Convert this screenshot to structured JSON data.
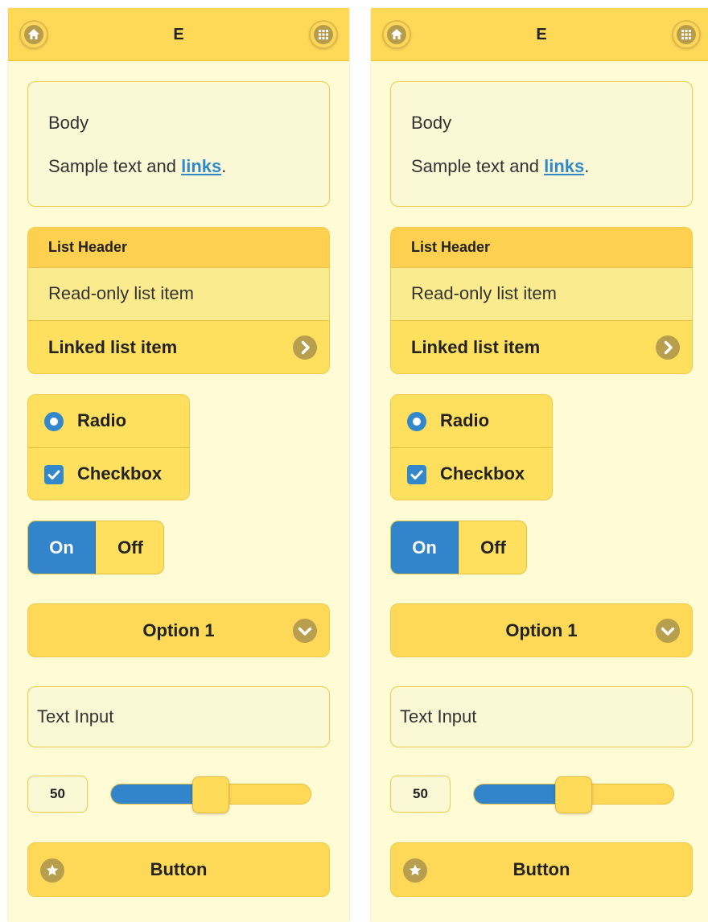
{
  "panels": [
    {
      "header": {
        "title": "E",
        "left_icon": "home-icon",
        "right_icon": "grid-icon"
      },
      "body": {
        "title": "Body",
        "text": "Sample text and ",
        "link": "links",
        "suffix": "."
      },
      "list": {
        "header": "List Header",
        "readonly_item": "Read-only list item",
        "linked_item": "Linked list item"
      },
      "choices": {
        "radio_label": "Radio",
        "checkbox_label": "Checkbox"
      },
      "flip": {
        "on_label": "On",
        "off_label": "Off"
      },
      "select": {
        "selected": "Option 1"
      },
      "text_input": {
        "placeholder": "Text Input"
      },
      "slider": {
        "value": "50",
        "fraction": 0.5
      },
      "button": {
        "label": "Button",
        "icon": "star-icon"
      }
    },
    {
      "header": {
        "title": "E",
        "left_icon": "home-icon",
        "right_icon": "grid-icon"
      },
      "body": {
        "title": "Body",
        "text": "Sample text and ",
        "link": "links",
        "suffix": "."
      },
      "list": {
        "header": "List Header",
        "readonly_item": "Read-only list item",
        "linked_item": "Linked list item"
      },
      "choices": {
        "radio_label": "Radio",
        "checkbox_label": "Checkbox"
      },
      "flip": {
        "on_label": "On",
        "off_label": "Off"
      },
      "select": {
        "selected": "Option 1"
      },
      "text_input": {
        "placeholder": "Text Input"
      },
      "slider": {
        "value": "50",
        "fraction": 0.5
      },
      "button": {
        "label": "Button",
        "icon": "star-icon"
      }
    }
  ],
  "colors": {
    "accent": "#3388cc",
    "bar": "#fed958",
    "background": "#fffcd5",
    "icon_disc": "#b89f4e"
  }
}
